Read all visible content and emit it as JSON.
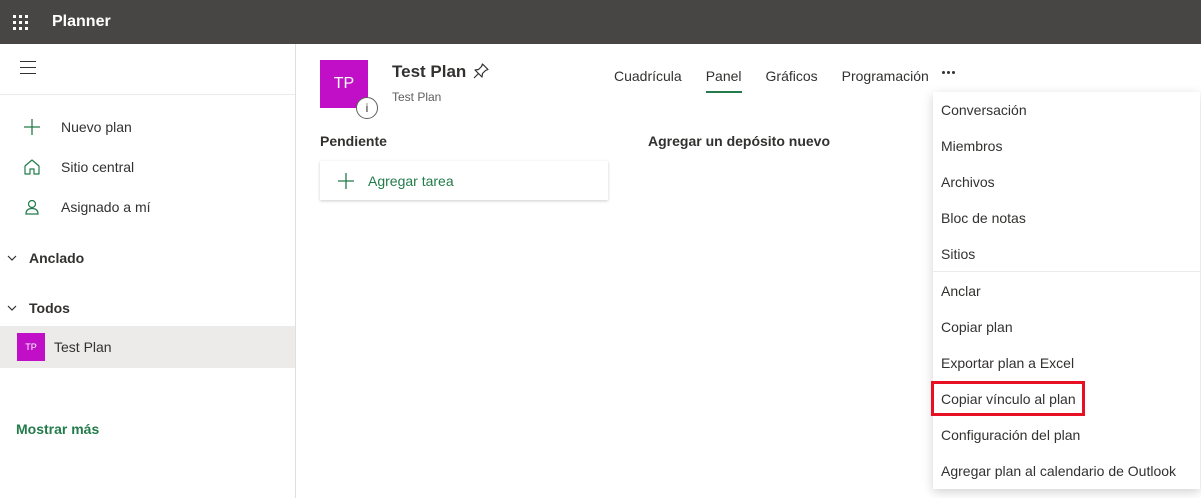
{
  "app": {
    "title": "Planner"
  },
  "sidebar": {
    "nav": [
      {
        "label": "Nuevo plan",
        "icon": "plus-icon"
      },
      {
        "label": "Sitio central",
        "icon": "home-icon"
      },
      {
        "label": "Asignado a mí",
        "icon": "person-icon"
      }
    ],
    "sections": {
      "pinned": "Anclado",
      "all": "Todos"
    },
    "plan": {
      "initials": "TP",
      "name": "Test Plan"
    },
    "show_more": "Mostrar más"
  },
  "header": {
    "initials": "TP",
    "info": "i",
    "title": "Test Plan",
    "subtitle": "Test Plan",
    "tabs": [
      "Cuadrícula",
      "Panel",
      "Gráficos",
      "Programación"
    ],
    "active_tab": "Panel"
  },
  "board": {
    "bucket": "Pendiente",
    "add_task": "Agregar tarea",
    "new_bucket": "Agregar un depósito nuevo"
  },
  "menu": {
    "items": [
      "Conversación",
      "Miembros",
      "Archivos",
      "Bloc de notas",
      "Sitios",
      "Anclar",
      "Copiar plan",
      "Exportar plan a Excel",
      "Copiar vínculo al plan",
      "Configuración del plan",
      "Agregar plan al calendario de Outlook"
    ],
    "highlighted": "Copiar vínculo al plan"
  },
  "colors": {
    "topbar": "#484644",
    "accent": "#237b4b",
    "avatar": "#c10fc8",
    "highlight": "#e81123"
  }
}
